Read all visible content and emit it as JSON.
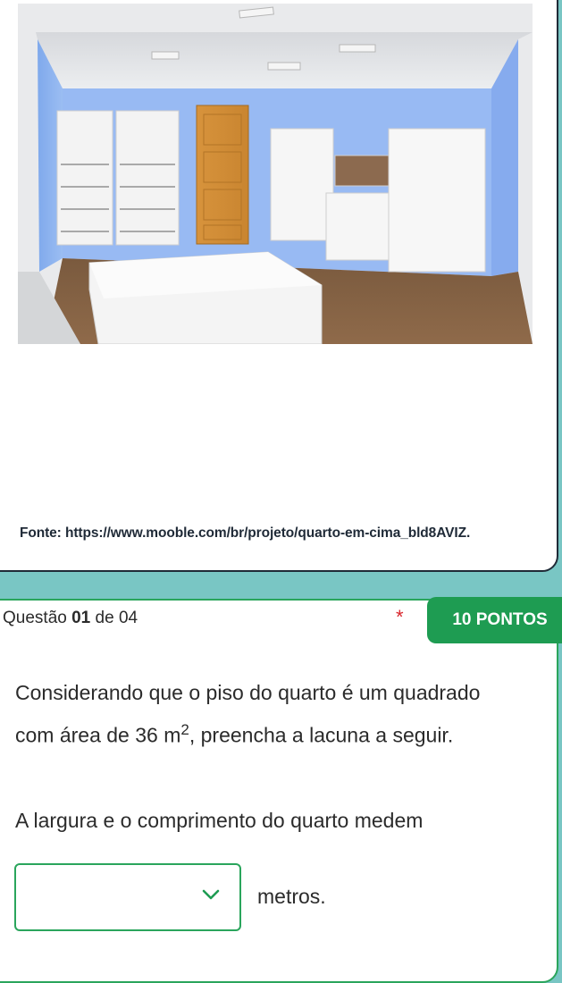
{
  "source_caption": "Fonte: https://www.mooble.com/br/projeto/quarto-em-cima_bld8AVIZ.",
  "question": {
    "label_prefix": "Questão",
    "number": "01",
    "label_of": "de 04",
    "required_marker": "*",
    "points": "10 PONTOS",
    "text_before_unit": "Considerando que o piso do quarto é um quadrado com área de 36 m",
    "unit_superscript": "2",
    "text_after_unit": ", preencha a lacuna a seguir.",
    "answer_sentence": "A largura e o comprimento do quarto medem",
    "dropdown_value": "",
    "unit_after_dropdown": "metros."
  },
  "colors": {
    "page_bg": "#79c6c4",
    "accent_green": "#1e9c52",
    "border_green": "#2aa55c",
    "dark_border": "#1f2a37",
    "required_red": "#d9262c"
  },
  "icons": {
    "dropdown": "chevron-down-icon"
  }
}
